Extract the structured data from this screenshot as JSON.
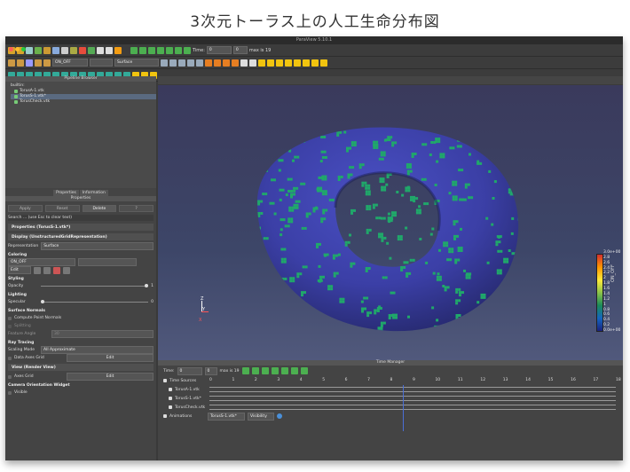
{
  "caption": "3次元トーラス上の人工生命分布図",
  "app": {
    "title": "ParaView 5.10.1"
  },
  "toolbar": {
    "time_label": "Time:",
    "time_value": "0",
    "max_label": "max is 19",
    "array_select": "ON_OFF",
    "representation_select": "Surface"
  },
  "pipeline": {
    "header": "Pipeline Browser",
    "items": [
      {
        "label": "builtin:"
      },
      {
        "label": "TorusA-1.vtk"
      },
      {
        "label": "TorusS-1.vtk*"
      },
      {
        "label": "TorusCheck.vtk"
      }
    ]
  },
  "tabs": {
    "properties": "Properties",
    "information": "Information"
  },
  "properties": {
    "header": "Properties",
    "apply": "Apply",
    "reset": "Reset",
    "delete": "Delete",
    "help": "?",
    "search_placeholder": "Search ... (use Esc to clear text)",
    "section_props": "Properties (TorusS-1.vtk*)",
    "section_display": "Display (UnstructuredGridRepresentation)",
    "representation_label": "Representation",
    "representation_value": "Surface",
    "coloring_label": "Coloring",
    "coloring_value": "ON_OFF",
    "edit_label": "Edit",
    "styling_label": "Styling",
    "opacity_label": "Opacity",
    "opacity_value": "1",
    "lighting_label": "Lighting",
    "specular_label": "Specular",
    "specular_value": "0",
    "surface_normals_label": "Surface Normals",
    "compute_normals": "Compute Point Normals",
    "splitting": "Splitting",
    "feature_angle_label": "Feature Angle",
    "feature_angle_value": "30",
    "ray_tracing_label": "Ray Tracing",
    "scaling_mode_label": "Scaling Mode",
    "scaling_mode_value": "All Approximate",
    "data_axes_grid": "Data Axes Grid",
    "view_section": "View (Render View)",
    "axes_grid": "Axes Grid",
    "camera_widget": "Camera Orientation Widget",
    "visible": "Visible"
  },
  "legend": {
    "title": "ON_OFF",
    "ticks": [
      "3.0e+00",
      "2.8",
      "2.6",
      "2.4",
      "2.2",
      "2",
      "1.8",
      "1.6",
      "1.4",
      "1.2",
      "1",
      "0.8",
      "0.6",
      "0.4",
      "0.2",
      "0.0e+00"
    ]
  },
  "axes": {
    "x": "X",
    "y": "Y",
    "z": "Z"
  },
  "time_manager": {
    "header": "Time Manager",
    "time_label": "Time:",
    "time_value": "0",
    "index_value": "0",
    "max_label": "max is 19",
    "ticks": [
      "0",
      "1",
      "2",
      "3",
      "4",
      "5",
      "6",
      "7",
      "8",
      "9",
      "10",
      "11",
      "12",
      "13",
      "14",
      "15",
      "16",
      "17",
      "18"
    ],
    "rows": [
      {
        "label": "Time Sources"
      },
      {
        "label": "TorusA-1.vtk"
      },
      {
        "label": "TorusS-1.vtk*"
      },
      {
        "label": "TorusCheck.vtk"
      },
      {
        "label": "Animations"
      }
    ],
    "anim_source": "TorusS-1.vtk*",
    "anim_property": "Visibility"
  },
  "colors": {
    "torus": "#3b3fa6",
    "cells": "#20a86a",
    "accent": "#e05050"
  }
}
